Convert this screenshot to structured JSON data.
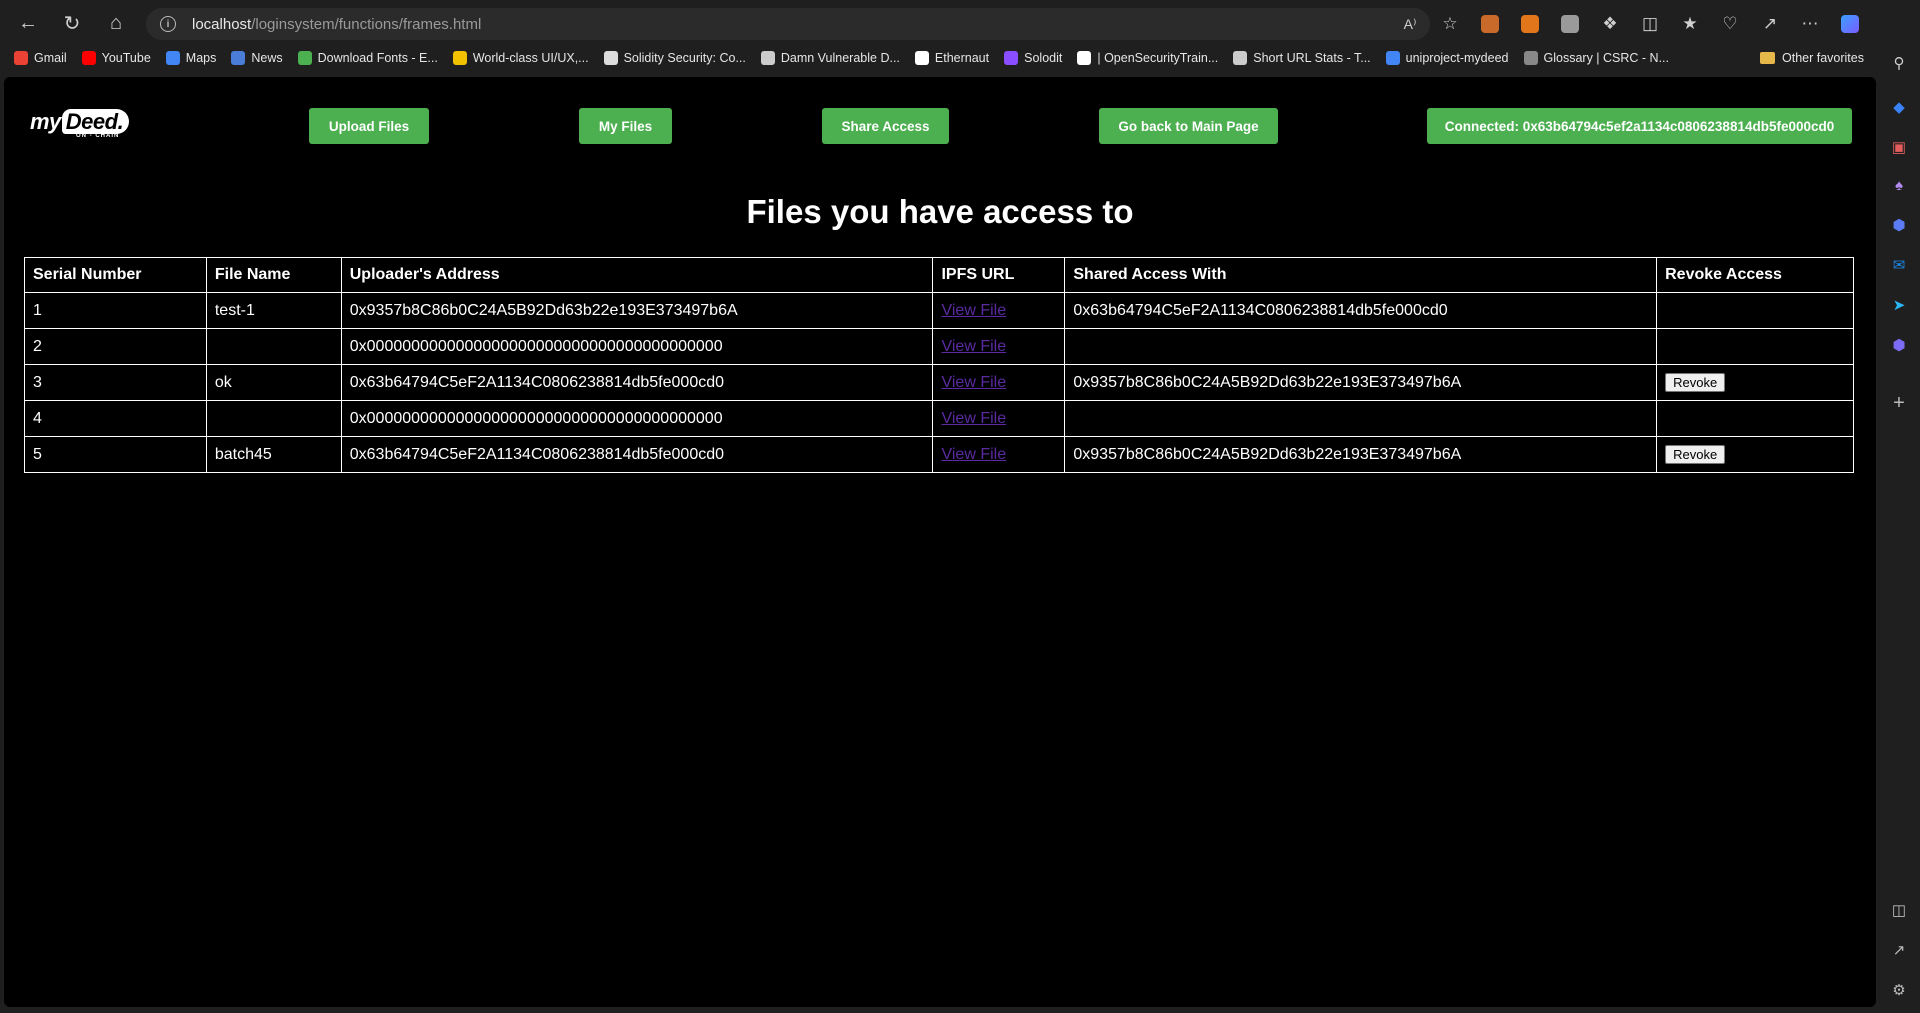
{
  "browser": {
    "url_host": "localhost",
    "url_path": "/loginsystem/functions/frames.html",
    "bookmarks": [
      {
        "label": "Gmail",
        "icon": "gmail-icon",
        "color": "#ea4335"
      },
      {
        "label": "YouTube",
        "icon": "youtube-icon",
        "color": "#ff0000"
      },
      {
        "label": "Maps",
        "icon": "google-icon",
        "color": "#4285f4"
      },
      {
        "label": "News",
        "icon": "news-icon",
        "color": "#4a7dd8"
      },
      {
        "label": "Download Fonts - E...",
        "icon": "leaf-icon",
        "color": "#4caf50"
      },
      {
        "label": "World-class UI/UX,...",
        "icon": "crown-icon",
        "color": "#f2c200"
      },
      {
        "label": "Solidity Security: Co...",
        "icon": "key-icon",
        "color": "#dddddd"
      },
      {
        "label": "Damn Vulnerable D...",
        "icon": "page-icon",
        "color": "#cccccc"
      },
      {
        "label": "Ethernaut",
        "icon": "ethernaut-icon",
        "color": "#ffffff"
      },
      {
        "label": "Solodit",
        "icon": "solodit-icon",
        "color": "#8a4dff"
      },
      {
        "label": "| OpenSecurityTrain...",
        "icon": "ost-icon",
        "color": "#ffffff"
      },
      {
        "label": "Short URL Stats - T...",
        "icon": "tree-icon",
        "color": "#cccccc"
      },
      {
        "label": "uniproject-mydeed",
        "icon": "docs-icon",
        "color": "#4285f4"
      },
      {
        "label": "Glossary | CSRC - N...",
        "icon": "nist-icon",
        "color": "#888888"
      }
    ],
    "other_favorites": "Other favorites"
  },
  "header": {
    "logo_main": "my",
    "logo_deed": "Deed.",
    "logo_sub": "ON - CHAIN",
    "upload_label": "Upload Files",
    "myfiles_label": "My Files",
    "share_label": "Share Access",
    "main_label": "Go back to Main Page",
    "connected_label": "Connected: 0x63b64794c5ef2a1134c0806238814db5fe000cd0"
  },
  "page_title": "Files you have access to",
  "table": {
    "columns": [
      "Serial Number",
      "File Name",
      "Uploader's Address",
      "IPFS URL",
      "Shared Access With",
      "Revoke Access"
    ],
    "rows": [
      {
        "serial": "1",
        "name": "test-1",
        "uploader": "0x9357b8C86b0C24A5B92Dd63b22e193E373497b6A",
        "link": "View File",
        "shared": "0x63b64794C5eF2A1134C0806238814db5fe000cd0",
        "revoke": ""
      },
      {
        "serial": "2",
        "name": "",
        "uploader": "0x0000000000000000000000000000000000000000",
        "link": "View File",
        "shared": "",
        "revoke": ""
      },
      {
        "serial": "3",
        "name": "ok",
        "uploader": "0x63b64794C5eF2A1134C0806238814db5fe000cd0",
        "link": "View File",
        "shared": "0x9357b8C86b0C24A5B92Dd63b22e193E373497b6A",
        "revoke": "Revoke"
      },
      {
        "serial": "4",
        "name": "",
        "uploader": "0x0000000000000000000000000000000000000000",
        "link": "View File",
        "shared": "",
        "revoke": ""
      },
      {
        "serial": "5",
        "name": "batch45",
        "uploader": "0x63b64794C5eF2A1134C0806238814db5fe000cd0",
        "link": "View File",
        "shared": "0x9357b8C86b0C24A5B92Dd63b22e193E373497b6A",
        "revoke": "Revoke"
      }
    ]
  },
  "colors": {
    "accent_green": "#4caf50",
    "page_bg": "#000000",
    "visited_link": "#5b2aa0"
  }
}
